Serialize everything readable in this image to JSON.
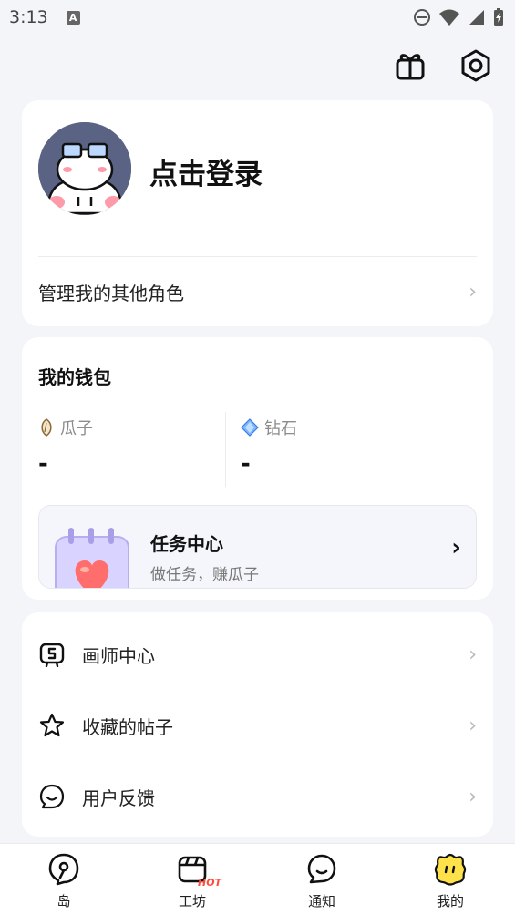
{
  "status_bar": {
    "time": "3:13",
    "notif_letter": "A"
  },
  "profile": {
    "login_text": "点击登录",
    "manage_roles": "管理我的其他角色"
  },
  "wallet": {
    "title": "我的钱包",
    "seeds_label": "瓜子",
    "seeds_value": "-",
    "diamonds_label": "钻石",
    "diamonds_value": "-"
  },
  "task": {
    "title": "任务中心",
    "subtitle": "做任务，赚瓜子"
  },
  "menu": [
    {
      "label": "画师中心",
      "icon": "artist-icon"
    },
    {
      "label": "收藏的帖子",
      "icon": "star-icon"
    },
    {
      "label": "用户反馈",
      "icon": "feedback-icon"
    }
  ],
  "nav": {
    "items": [
      {
        "label": "岛",
        "icon": "island-icon"
      },
      {
        "label": "工坊",
        "icon": "workshop-icon",
        "badge": "HOT"
      },
      {
        "label": "通知",
        "icon": "notification-icon"
      },
      {
        "label": "我的",
        "icon": "mine-icon"
      }
    ]
  },
  "colors": {
    "background": "#f4f5f9",
    "card": "#ffffff",
    "hot": "#ff4b3e",
    "avatar_bg": "#5a6383",
    "mine_yellow": "#ffe14a"
  }
}
